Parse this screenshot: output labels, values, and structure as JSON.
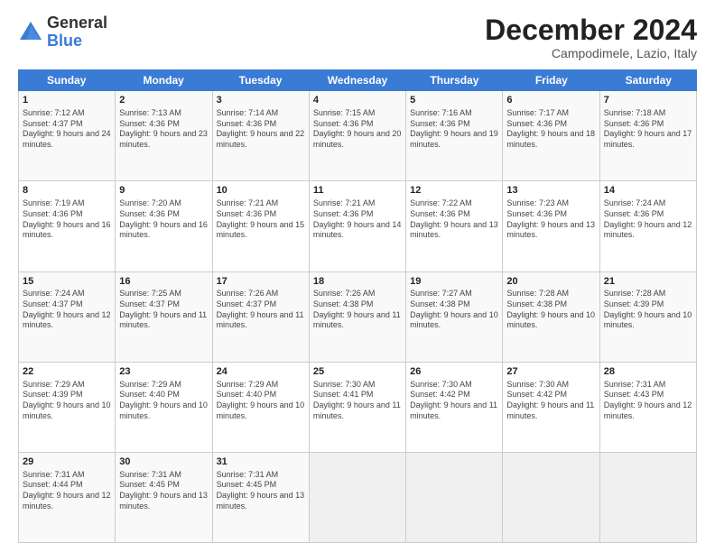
{
  "logo": {
    "general": "General",
    "blue": "Blue"
  },
  "title": "December 2024",
  "location": "Campodimele, Lazio, Italy",
  "days_header": [
    "Sunday",
    "Monday",
    "Tuesday",
    "Wednesday",
    "Thursday",
    "Friday",
    "Saturday"
  ],
  "weeks": [
    [
      {
        "day": "1",
        "sunrise": "Sunrise: 7:12 AM",
        "sunset": "Sunset: 4:37 PM",
        "daylight": "Daylight: 9 hours and 24 minutes."
      },
      {
        "day": "2",
        "sunrise": "Sunrise: 7:13 AM",
        "sunset": "Sunset: 4:36 PM",
        "daylight": "Daylight: 9 hours and 23 minutes."
      },
      {
        "day": "3",
        "sunrise": "Sunrise: 7:14 AM",
        "sunset": "Sunset: 4:36 PM",
        "daylight": "Daylight: 9 hours and 22 minutes."
      },
      {
        "day": "4",
        "sunrise": "Sunrise: 7:15 AM",
        "sunset": "Sunset: 4:36 PM",
        "daylight": "Daylight: 9 hours and 20 minutes."
      },
      {
        "day": "5",
        "sunrise": "Sunrise: 7:16 AM",
        "sunset": "Sunset: 4:36 PM",
        "daylight": "Daylight: 9 hours and 19 minutes."
      },
      {
        "day": "6",
        "sunrise": "Sunrise: 7:17 AM",
        "sunset": "Sunset: 4:36 PM",
        "daylight": "Daylight: 9 hours and 18 minutes."
      },
      {
        "day": "7",
        "sunrise": "Sunrise: 7:18 AM",
        "sunset": "Sunset: 4:36 PM",
        "daylight": "Daylight: 9 hours and 17 minutes."
      }
    ],
    [
      {
        "day": "8",
        "sunrise": "Sunrise: 7:19 AM",
        "sunset": "Sunset: 4:36 PM",
        "daylight": "Daylight: 9 hours and 16 minutes."
      },
      {
        "day": "9",
        "sunrise": "Sunrise: 7:20 AM",
        "sunset": "Sunset: 4:36 PM",
        "daylight": "Daylight: 9 hours and 16 minutes."
      },
      {
        "day": "10",
        "sunrise": "Sunrise: 7:21 AM",
        "sunset": "Sunset: 4:36 PM",
        "daylight": "Daylight: 9 hours and 15 minutes."
      },
      {
        "day": "11",
        "sunrise": "Sunrise: 7:21 AM",
        "sunset": "Sunset: 4:36 PM",
        "daylight": "Daylight: 9 hours and 14 minutes."
      },
      {
        "day": "12",
        "sunrise": "Sunrise: 7:22 AM",
        "sunset": "Sunset: 4:36 PM",
        "daylight": "Daylight: 9 hours and 13 minutes."
      },
      {
        "day": "13",
        "sunrise": "Sunrise: 7:23 AM",
        "sunset": "Sunset: 4:36 PM",
        "daylight": "Daylight: 9 hours and 13 minutes."
      },
      {
        "day": "14",
        "sunrise": "Sunrise: 7:24 AM",
        "sunset": "Sunset: 4:36 PM",
        "daylight": "Daylight: 9 hours and 12 minutes."
      }
    ],
    [
      {
        "day": "15",
        "sunrise": "Sunrise: 7:24 AM",
        "sunset": "Sunset: 4:37 PM",
        "daylight": "Daylight: 9 hours and 12 minutes."
      },
      {
        "day": "16",
        "sunrise": "Sunrise: 7:25 AM",
        "sunset": "Sunset: 4:37 PM",
        "daylight": "Daylight: 9 hours and 11 minutes."
      },
      {
        "day": "17",
        "sunrise": "Sunrise: 7:26 AM",
        "sunset": "Sunset: 4:37 PM",
        "daylight": "Daylight: 9 hours and 11 minutes."
      },
      {
        "day": "18",
        "sunrise": "Sunrise: 7:26 AM",
        "sunset": "Sunset: 4:38 PM",
        "daylight": "Daylight: 9 hours and 11 minutes."
      },
      {
        "day": "19",
        "sunrise": "Sunrise: 7:27 AM",
        "sunset": "Sunset: 4:38 PM",
        "daylight": "Daylight: 9 hours and 10 minutes."
      },
      {
        "day": "20",
        "sunrise": "Sunrise: 7:28 AM",
        "sunset": "Sunset: 4:38 PM",
        "daylight": "Daylight: 9 hours and 10 minutes."
      },
      {
        "day": "21",
        "sunrise": "Sunrise: 7:28 AM",
        "sunset": "Sunset: 4:39 PM",
        "daylight": "Daylight: 9 hours and 10 minutes."
      }
    ],
    [
      {
        "day": "22",
        "sunrise": "Sunrise: 7:29 AM",
        "sunset": "Sunset: 4:39 PM",
        "daylight": "Daylight: 9 hours and 10 minutes."
      },
      {
        "day": "23",
        "sunrise": "Sunrise: 7:29 AM",
        "sunset": "Sunset: 4:40 PM",
        "daylight": "Daylight: 9 hours and 10 minutes."
      },
      {
        "day": "24",
        "sunrise": "Sunrise: 7:29 AM",
        "sunset": "Sunset: 4:40 PM",
        "daylight": "Daylight: 9 hours and 10 minutes."
      },
      {
        "day": "25",
        "sunrise": "Sunrise: 7:30 AM",
        "sunset": "Sunset: 4:41 PM",
        "daylight": "Daylight: 9 hours and 11 minutes."
      },
      {
        "day": "26",
        "sunrise": "Sunrise: 7:30 AM",
        "sunset": "Sunset: 4:42 PM",
        "daylight": "Daylight: 9 hours and 11 minutes."
      },
      {
        "day": "27",
        "sunrise": "Sunrise: 7:30 AM",
        "sunset": "Sunset: 4:42 PM",
        "daylight": "Daylight: 9 hours and 11 minutes."
      },
      {
        "day": "28",
        "sunrise": "Sunrise: 7:31 AM",
        "sunset": "Sunset: 4:43 PM",
        "daylight": "Daylight: 9 hours and 12 minutes."
      }
    ],
    [
      {
        "day": "29",
        "sunrise": "Sunrise: 7:31 AM",
        "sunset": "Sunset: 4:44 PM",
        "daylight": "Daylight: 9 hours and 12 minutes."
      },
      {
        "day": "30",
        "sunrise": "Sunrise: 7:31 AM",
        "sunset": "Sunset: 4:45 PM",
        "daylight": "Daylight: 9 hours and 13 minutes."
      },
      {
        "day": "31",
        "sunrise": "Sunrise: 7:31 AM",
        "sunset": "Sunset: 4:45 PM",
        "daylight": "Daylight: 9 hours and 13 minutes."
      },
      null,
      null,
      null,
      null
    ]
  ]
}
